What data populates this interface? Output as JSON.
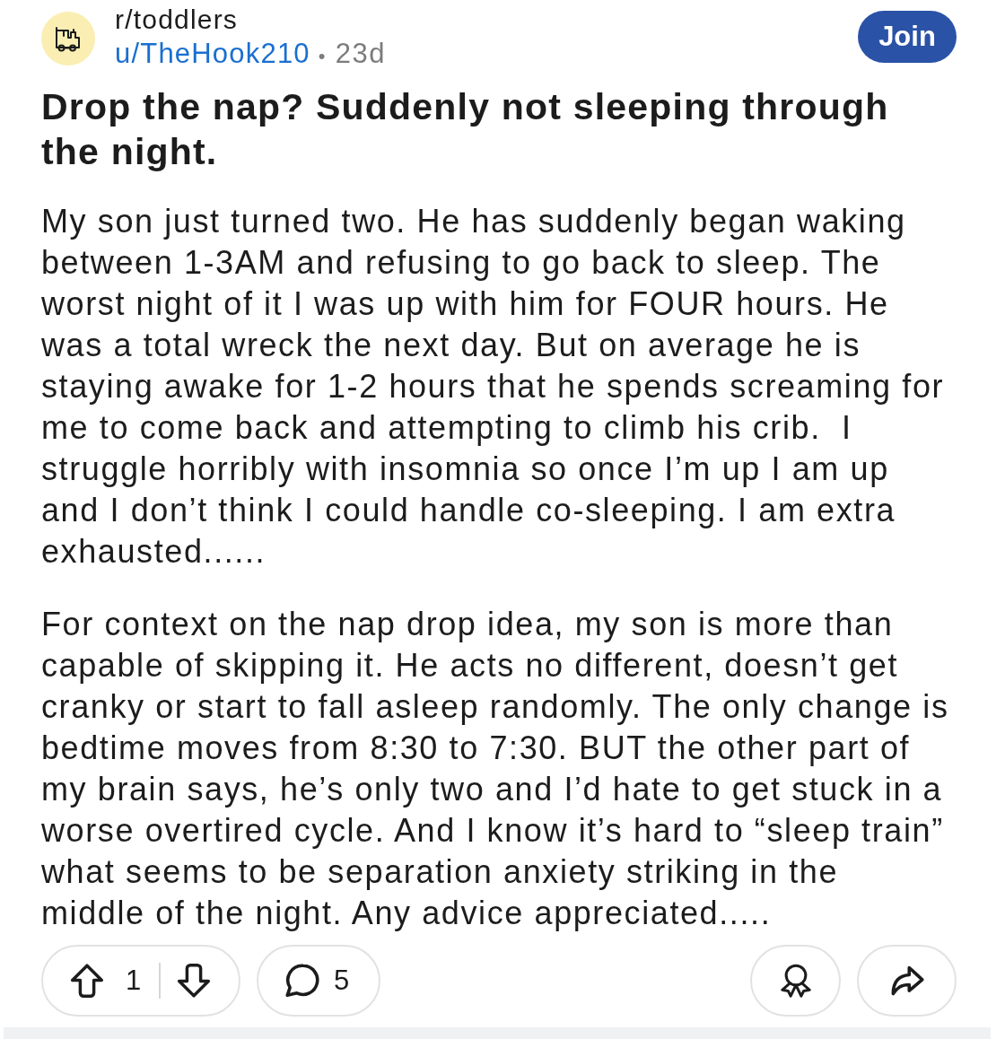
{
  "post": {
    "subreddit": "r/toddlers",
    "author": "u/TheHook210",
    "separator": "•",
    "age": "23d",
    "join_button": "Join",
    "title": "Drop the nap? Suddenly not sleeping through the night.",
    "body": [
      "My son just turned two. He has suddenly began waking between 1-3AM and refusing to go back to sleep. The worst night of it I was up with him for FOUR hours. He was a total wreck the next day. But on average he is staying awake for 1-2 hours that he spends screaming for me to come back and attempting to climb his crib.  I struggle horribly with insomnia so once I’m up I am up and I don’t think I could handle co-sleeping. I am extra exhausted......",
      "For context on the nap drop idea, my son is more than capable of skipping it. He acts no different, doesn’t get cranky or start to fall asleep randomly. The only change is bedtime moves from 8:30 to 7:30. BUT the other part of my brain says, he’s only two and I’d hate to get stuck in a worse overtired cycle. And I know it’s hard to “sleep train” what seems to be separation anxiety striking in the middle of the night. Any advice appreciated....."
    ]
  },
  "actions": {
    "votes": "1",
    "comments": "5"
  }
}
